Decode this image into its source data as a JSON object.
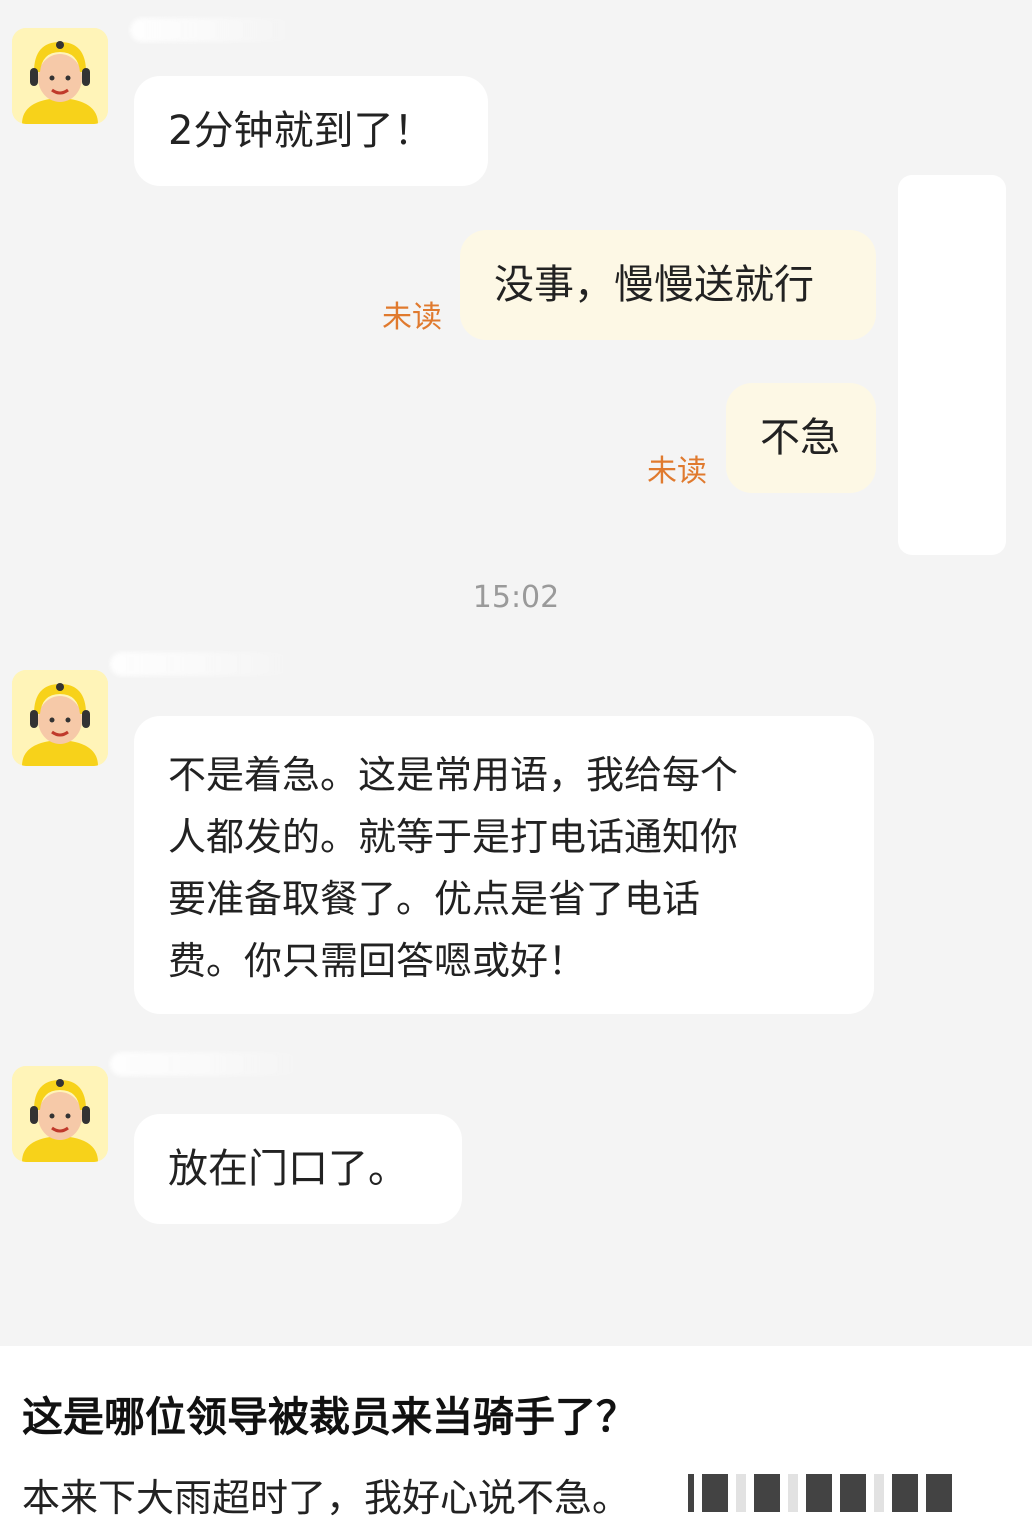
{
  "messages": [
    {
      "text": "2分钟就到了！"
    },
    {
      "text": "没事，慢慢送就行",
      "status": "未读"
    },
    {
      "text": "不急",
      "status": "未读"
    },
    {
      "lines": [
        "不是着急。这是常用语，我给每个",
        "人都发的。就等于是打电话通知你",
        "要准备取餐了。优点是省了电话",
        "费。你只需回答嗯或好！"
      ]
    },
    {
      "text": "放在门口了。"
    }
  ],
  "timestamp": "15:02",
  "caption": {
    "title": "这是哪位领导被裁员来当骑手了？",
    "body": "本来下大雨超时了，我好心说不急。"
  },
  "colors": {
    "background": "#f4f4f4",
    "sent_bubble": "#fdf8e5",
    "received_bubble": "#ffffff",
    "unread": "#e07a2e",
    "avatar_bg": "#fff4b8"
  },
  "icons": {
    "avatar": "delivery-rider-avatar-icon"
  }
}
